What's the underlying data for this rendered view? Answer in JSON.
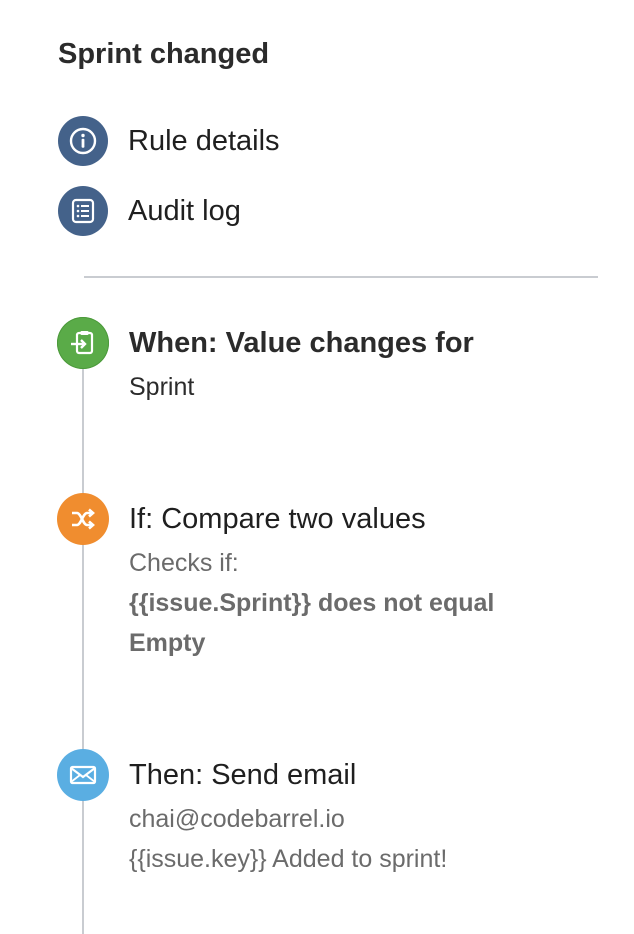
{
  "rule": {
    "title": "Sprint changed"
  },
  "menu": {
    "items": [
      {
        "label": "Rule details",
        "icon": "info-icon"
      },
      {
        "label": "Audit log",
        "icon": "list-icon"
      }
    ]
  },
  "steps": {
    "trigger": {
      "heading": "When: Value changes for",
      "detail": "Sprint",
      "icon": "trigger-icon",
      "color": "#5aab48"
    },
    "condition": {
      "heading": "If: Compare two values",
      "intro": "Checks if:",
      "expression": "{{issue.Sprint}} does not equal Empty",
      "icon": "shuffle-icon",
      "color": "#f08d2f"
    },
    "action": {
      "heading": "Then: Send email",
      "recipient": "chai@codebarrel.io",
      "subject": "{{issue.key}} Added to sprint!",
      "icon": "envelope-icon",
      "color": "#5aaee2"
    }
  },
  "colors": {
    "menu_icon_bg": "#44628a",
    "divider": "#c9ccd1"
  }
}
